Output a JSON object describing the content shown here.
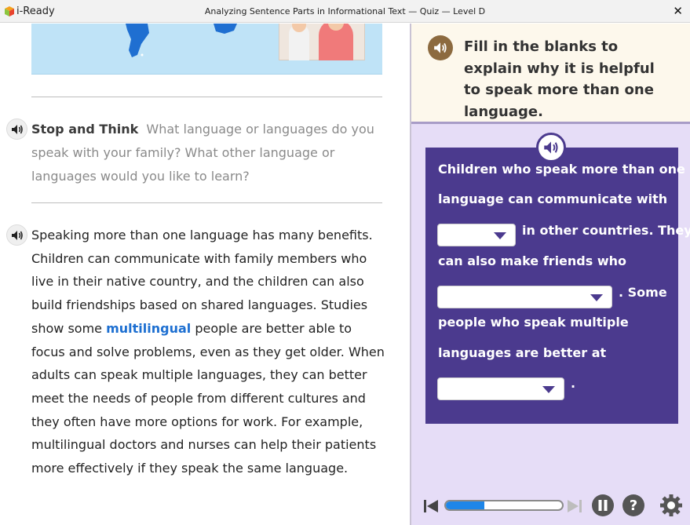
{
  "titlebar": {
    "brand": "i-Ready",
    "title": "Analyzing Sentence Parts in Informational Text — Quiz — Level D",
    "close": "✕"
  },
  "passage": {
    "stop_think_lead": "Stop and Think",
    "stop_think_text": "What language or languages do you speak with your family? What other language or languages would you like to learn?",
    "text_before": "Speaking more than one language has many benefits. Children can communicate with family members who live in their native country, and the children can also build friendships based on shared languages. Studies show some",
    "glossary_word": "multilingual",
    "text_after": "people are better able to focus and solve problems, even as they get older. When adults can speak multiple languages, they can better meet the needs of people from different cultures and they often have more options for work. For example, multilingual doctors and nurses can help their patients more effectively if they speak the same language."
  },
  "question": {
    "prompt": "Fill in the blanks to explain why it is helpful to speak more than one language.",
    "lines": [
      "Children who speak more than one",
      "language can communicate with",
      "in other countries. They",
      "can also make friends who",
      ". Some",
      "people who speak multiple",
      "languages are better at",
      "."
    ],
    "blanks": [
      {
        "selected": ""
      },
      {
        "selected": ""
      },
      {
        "selected": ""
      }
    ]
  },
  "progress": {
    "value": 0.33
  },
  "colors": {
    "card": "#4b3a8e",
    "prompt_bg": "#fdf8ec",
    "panel_bg": "#e6ddf7",
    "link": "#1d6fd1",
    "progress": "#1e86e8"
  },
  "icons": [
    "speaker-icon",
    "skip-back-icon",
    "skip-forward-icon",
    "pause-icon",
    "help-icon",
    "gear-icon",
    "close-icon"
  ]
}
